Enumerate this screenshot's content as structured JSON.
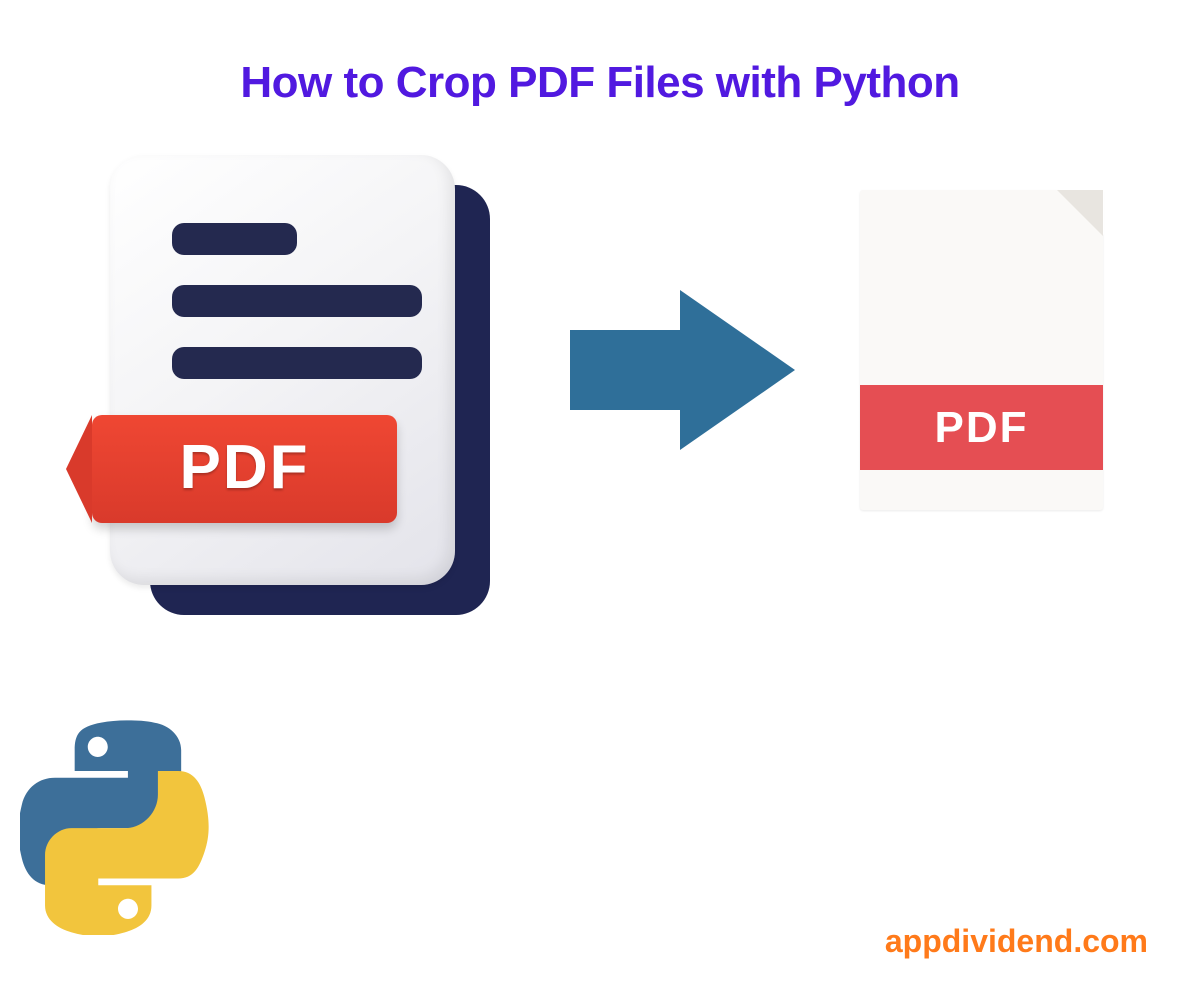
{
  "title": "How to Crop PDF Files with Python",
  "left_doc": {
    "ribbon_label": "PDF"
  },
  "right_doc": {
    "band_label": "PDF"
  },
  "watermark": "appdividend.com",
  "icons": {
    "arrow": "arrow-right-icon",
    "python": "python-logo-icon",
    "pdf_big": "pdf-document-icon",
    "pdf_small": "pdf-file-icon"
  },
  "colors": {
    "title": "#5119e0",
    "arrow": "#2f6f99",
    "ribbon": "#ef4733",
    "band": "#e54e53",
    "wm": "#ff7a1a",
    "py_blue": "#3d6f99",
    "py_yellow": "#f2c53d"
  }
}
